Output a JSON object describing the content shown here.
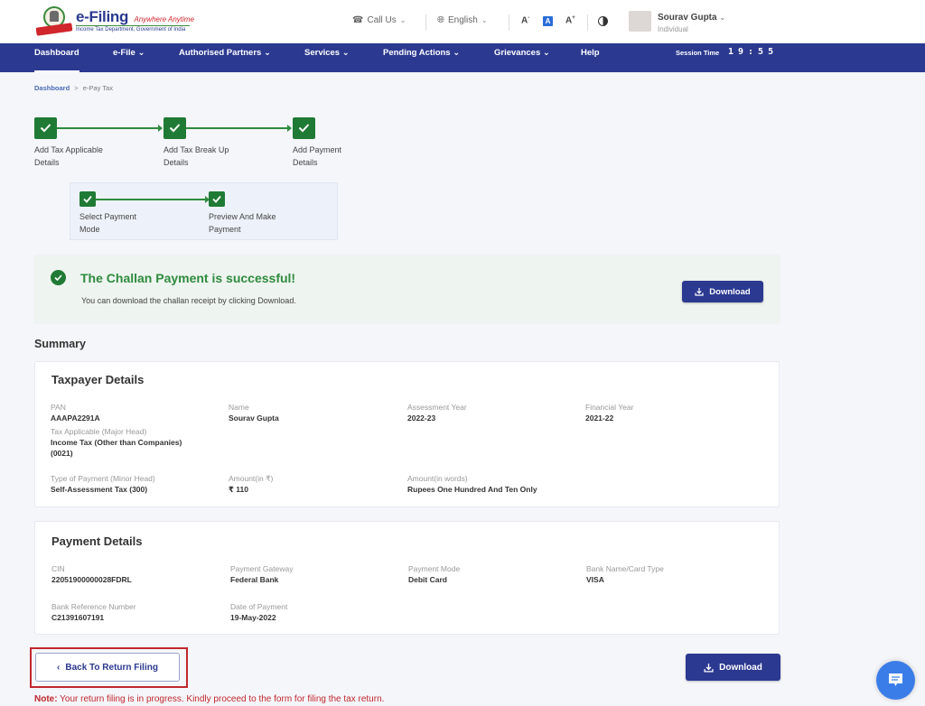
{
  "header": {
    "brand_main": "e-Filing",
    "brand_tagline": "Anywhere Anytime",
    "brand_subtitle": "Income Tax Department, Government of India",
    "call_us": "Call Us",
    "language": "English",
    "font_decrease": "A",
    "font_normal": "A",
    "font_increase": "A",
    "user_name": "Sourav Gupta",
    "user_role": "Individual"
  },
  "nav": {
    "items": [
      {
        "label": "Dashboard",
        "dropdown": false,
        "active": true
      },
      {
        "label": "e-File",
        "dropdown": true
      },
      {
        "label": "Authorised Partners",
        "dropdown": true
      },
      {
        "label": "Services",
        "dropdown": true
      },
      {
        "label": "Pending Actions",
        "dropdown": true
      },
      {
        "label": "Grievances",
        "dropdown": true
      },
      {
        "label": "Help",
        "dropdown": false
      }
    ],
    "session_label": "Session Time",
    "session_time": "19:55"
  },
  "breadcrumb": {
    "root": "Dashboard",
    "separator": ">",
    "current": "e-Pay Tax"
  },
  "stepper": {
    "steps": [
      {
        "line1": "Add Tax Applicable",
        "line2": "Details",
        "status": "complete"
      },
      {
        "line1": "Add Tax Break Up",
        "line2": "Details",
        "status": "complete"
      },
      {
        "line1": "Add Payment",
        "line2": "Details",
        "status": "complete"
      }
    ],
    "substeps": [
      {
        "line1": "Select Payment",
        "line2": "Mode",
        "status": "complete"
      },
      {
        "line1": "Preview And Make",
        "line2": "Payment",
        "status": "complete"
      }
    ]
  },
  "success": {
    "title": "The Challan Payment is successful!",
    "message": "You can download the challan receipt by clicking Download.",
    "download_label": "Download"
  },
  "summary": {
    "title": "Summary",
    "taxpayer": {
      "title": "Taxpayer Details",
      "pan_label": "PAN",
      "pan": "AAAPA2291A",
      "name_label": "Name",
      "name": "Sourav Gupta",
      "ay_label": "Assessment Year",
      "ay": "2022-23",
      "fy_label": "Financial Year",
      "fy": "2021-22",
      "major_head_label": "Tax Applicable (Major Head)",
      "major_head_line1": "Income Tax (Other than Companies)",
      "major_head_line2": "(0021)",
      "minor_head_label": "Type of Payment (Minor Head)",
      "minor_head": "Self-Assessment Tax (300)",
      "amount_label": "Amount(in ₹)",
      "amount": "₹ 110",
      "amount_words_label": "Amount(in words)",
      "amount_words": "Rupees One Hundred And Ten Only"
    },
    "payment": {
      "title": "Payment Details",
      "cin_label": "CIN",
      "cin": "22051900000028FDRL",
      "gateway_label": "Payment Gateway",
      "gateway": "Federal Bank",
      "mode_label": "Payment Mode",
      "mode": "Debit Card",
      "bank_label": "Bank Name/Card Type",
      "bank": "VISA",
      "bank_ref_label": "Bank Reference Number",
      "bank_ref": "C21391607191",
      "date_label": "Date of Payment",
      "date": "19-May-2022"
    }
  },
  "footer": {
    "back_label": "Back To Return Filing",
    "download_label": "Download",
    "note_prefix": "Note:",
    "note_text": " Your return filing is in progress. Kindly proceed to the form for filing the tax return."
  },
  "colors": {
    "brand_blue": "#2b3990",
    "success_green": "#1f7a35",
    "note_red": "#c0282d",
    "chat_blue": "#3b7de8"
  }
}
